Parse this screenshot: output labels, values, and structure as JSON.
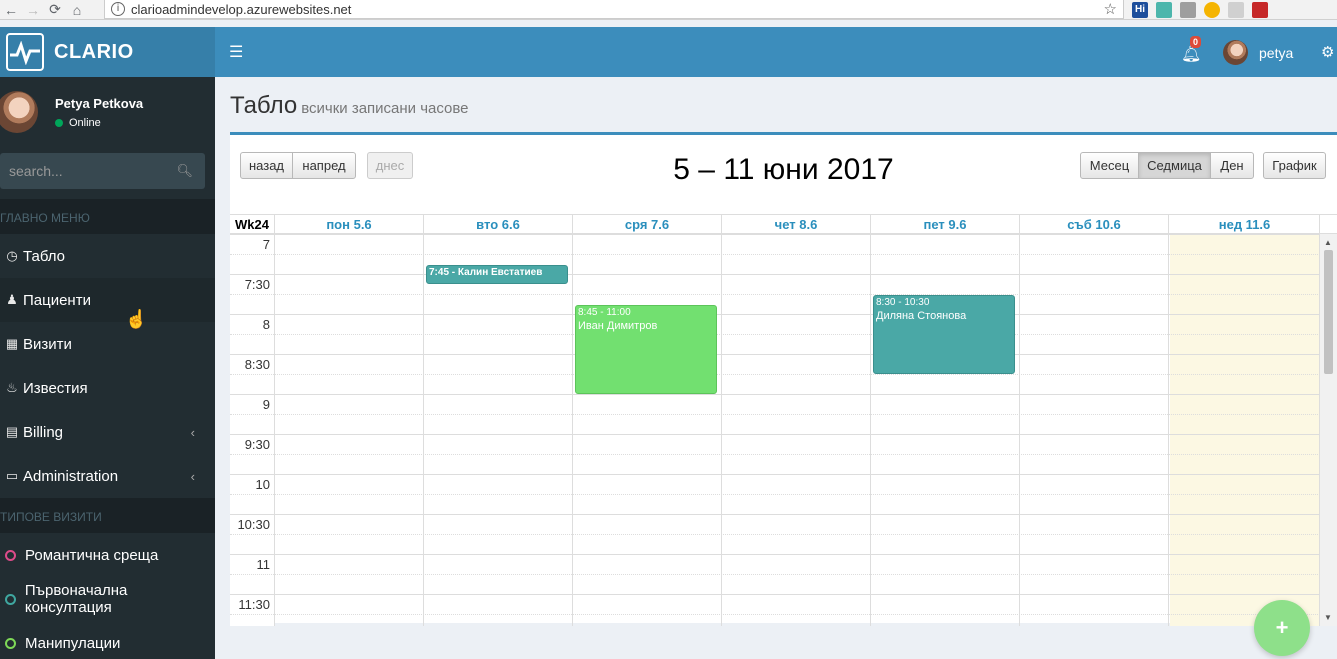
{
  "browser": {
    "url": "clarioadmindevelop.azurewebsites.net",
    "back": "←",
    "forward": "→",
    "reload": "⟳",
    "home": "⌂",
    "info": "i",
    "star": "☆"
  },
  "app": {
    "brand": "CLARIO"
  },
  "user": {
    "name": "Petya Petkova",
    "status": "Online",
    "short": "petya",
    "notifications": "0"
  },
  "search": {
    "placeholder": "search..."
  },
  "sidebar": {
    "main_header": "ГЛАВНО МЕНЮ",
    "items": [
      {
        "label": "Табло",
        "icon": "dashboard-icon"
      },
      {
        "label": "Пациенти",
        "icon": "users-icon"
      },
      {
        "label": "Визити",
        "icon": "calendar-icon"
      },
      {
        "label": "Известия",
        "icon": "bell-icon"
      },
      {
        "label": "Billing",
        "icon": "credit-card-icon"
      },
      {
        "label": "Administration",
        "icon": "desktop-icon"
      }
    ],
    "types_header": "ТИПОВЕ ВИЗИТИ",
    "types": [
      {
        "label": "Романтична среща",
        "color": "#dd4b8a"
      },
      {
        "label": "Първоначална консултация",
        "color": "#3fa7a0"
      },
      {
        "label": "Манипулации",
        "color": "#7ed957"
      }
    ]
  },
  "page": {
    "title": "Табло",
    "subtitle": "всички записани часове"
  },
  "calendar": {
    "prev": "назад",
    "next": "напред",
    "today": "днес",
    "title": "5 – 11 юни 2017",
    "views": [
      "Месец",
      "Седмица",
      "Ден"
    ],
    "active_view": "Седмица",
    "schedule": "График",
    "week_label": "Wk24",
    "days": [
      "пон 5.6",
      "вто 6.6",
      "сря 7.6",
      "чет 8.6",
      "пет 9.6",
      "съб 10.6",
      "нед 11.6"
    ],
    "times": [
      "7",
      "7:30",
      "8",
      "8:30",
      "9",
      "9:30",
      "10",
      "10:30",
      "11",
      "11:30"
    ],
    "events": [
      {
        "day": 1,
        "start": "7:45",
        "end": "",
        "time": "7:45 - Калин Евстатиев",
        "title": "",
        "color": "#4aa8a6"
      },
      {
        "day": 2,
        "start": "8:45",
        "end": "11:00",
        "time": "8:45 - 11:00",
        "title": "Иван Димитров",
        "color": "#72e070"
      },
      {
        "day": 4,
        "start": "8:30",
        "end": "10:30",
        "time": "8:30 - 10:30",
        "title": "Диляна Стоянова",
        "color": "#4aa8a6"
      }
    ]
  },
  "fab": {
    "label": "+"
  }
}
